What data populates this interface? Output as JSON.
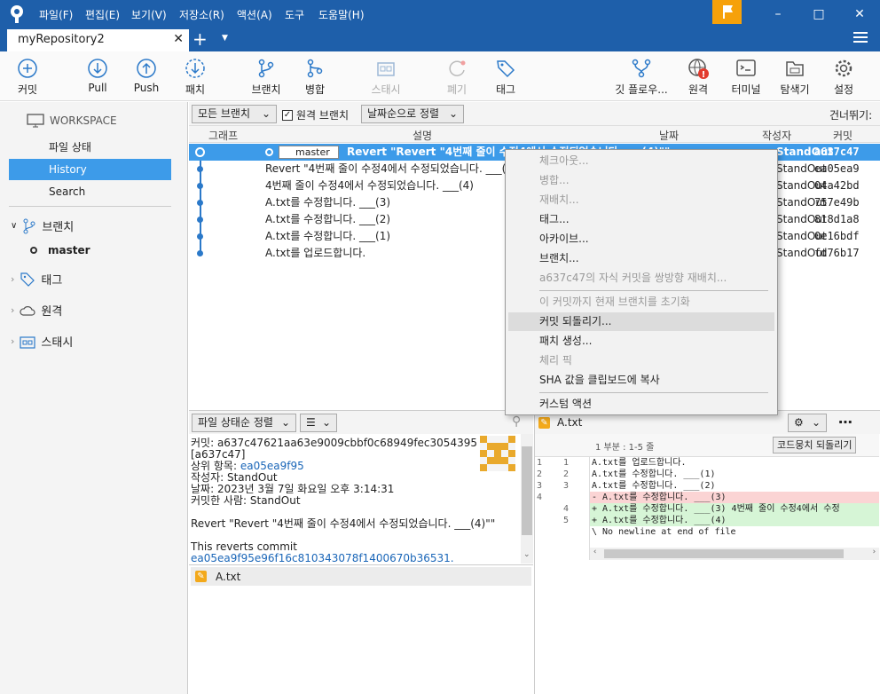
{
  "menu": [
    "파일(F)",
    "편집(E)",
    "보기(V)",
    "저장소(R)",
    "액션(A)",
    "도구",
    "도움말(H)"
  ],
  "tab": {
    "title": "myRepository2"
  },
  "toolbar": {
    "commit": "커밋",
    "pull": "Pull",
    "push": "Push",
    "fetch": "패치",
    "branch": "브랜치",
    "merge": "병합",
    "stash": "스태시",
    "discard": "폐기",
    "tag": "태그",
    "gitflow": "깃 플로우...",
    "remote": "원격",
    "terminal": "터미널",
    "explorer": "탐색기",
    "settings": "설정"
  },
  "sidebar": {
    "workspace": "WORKSPACE",
    "file_status": "파일 상태",
    "history": "History",
    "search": "Search",
    "branches": "브랜치",
    "master": "master",
    "tags": "태그",
    "remotes": "원격",
    "stashes": "스태시"
  },
  "filter": {
    "all_branches": "모든 브랜치",
    "remote_branches": "원격 브랜치",
    "sort": "날짜순으로 정렬",
    "jump": "건너뛰기:"
  },
  "columns": {
    "graph": "그래프",
    "desc": "설명",
    "date": "날짜",
    "author": "작성자",
    "commit": "커밋"
  },
  "commits": [
    {
      "branch": "master",
      "msg": "Revert \"Revert \"4번째 줄이 수정4에서 수정되었습니다. ___(4)\"\"",
      "author": "StandOut",
      "hash": "a637c47"
    },
    {
      "msg": "Revert \"4번째 줄이 수정4에서 수정되었습니다. ___(4)\"",
      "author": "StandOut",
      "hash": "ea05ea9"
    },
    {
      "msg": "4번째 줄이 수정4에서 수정되었습니다. ___(4)",
      "author": "StandOut",
      "hash": "04a42bd"
    },
    {
      "msg": "A.txt를 수정합니다. ___(3)",
      "author": "StandOut",
      "hash": "757e49b"
    },
    {
      "msg": "A.txt를 수정합니다. ___(2)",
      "author": "StandOut",
      "hash": "818d1a8"
    },
    {
      "msg": "A.txt를 수정합니다. ___(1)",
      "author": "StandOut",
      "hash": "0e16bdf"
    },
    {
      "msg": "A.txt를 업로드합니다.",
      "author": "StandOut",
      "hash": "fd76b17"
    }
  ],
  "context_menu": {
    "checkout": "체크아웃...",
    "merge": "병합...",
    "rebase": "재배치...",
    "tag": "태그...",
    "archive": "아카이브...",
    "branch": "브랜치...",
    "rebase_children": "a637c47의 자식 커밋을 쌍방향 재배치...",
    "reset": "이 커밋까지 현재 브랜치를 초기화",
    "revert": "커밋 되돌리기...",
    "patch": "패치 생성...",
    "cherry": "체리 픽",
    "copy_sha": "SHA 값을 클립보드에 복사",
    "custom": "커스텀 액션"
  },
  "bottom_left": {
    "sort": "파일 상태순 정렬",
    "file": "A.txt"
  },
  "details": {
    "commit_line": "커밋: a637c47621aa63e9009cbbf0c68949fec3054395",
    "short": "[a637c47]",
    "parent_label": "상위 항목: ",
    "parent": "ea05ea9f95",
    "author": "작성자: StandOut",
    "date": "날짜: 2023년 3월 7일 화요일 오후 3:14:31",
    "committer": "커밋한 사람: StandOut",
    "message": "Revert \"Revert \"4번째 줄이 수정4에서 수정되었습니다. ___(4)\"\"",
    "reverts": "This reverts commit",
    "reverts_hash": "ea05ea9f95e96f16c810343078f1400670b36531."
  },
  "diff": {
    "file": "A.txt",
    "hunk": "1 부분 : 1-5 줄",
    "revert_hunk": "코드뭉치 되돌리기",
    "lines": [
      {
        "n1": "1",
        "n2": "1",
        "t": "  A.txt를 업로드합니다.",
        "k": ""
      },
      {
        "n1": "2",
        "n2": "2",
        "t": "  A.txt를 수정합니다. ___(1)",
        "k": ""
      },
      {
        "n1": "3",
        "n2": "3",
        "t": "  A.txt를 수정합니다. ___(2)",
        "k": ""
      },
      {
        "n1": "4",
        "n2": "",
        "t": "- A.txt를 수정합니다. ___(3)",
        "k": "del"
      },
      {
        "n1": "",
        "n2": "4",
        "t": "+ A.txt를 수정합니다. ___(3) 4번째 줄이 수정4에서 수정",
        "k": "add"
      },
      {
        "n1": "",
        "n2": "5",
        "t": "+ A.txt를 수정합니다. ___(4)",
        "k": "add"
      },
      {
        "n1": "",
        "n2": "",
        "t": "\\ No newline at end of file",
        "k": ""
      }
    ]
  }
}
